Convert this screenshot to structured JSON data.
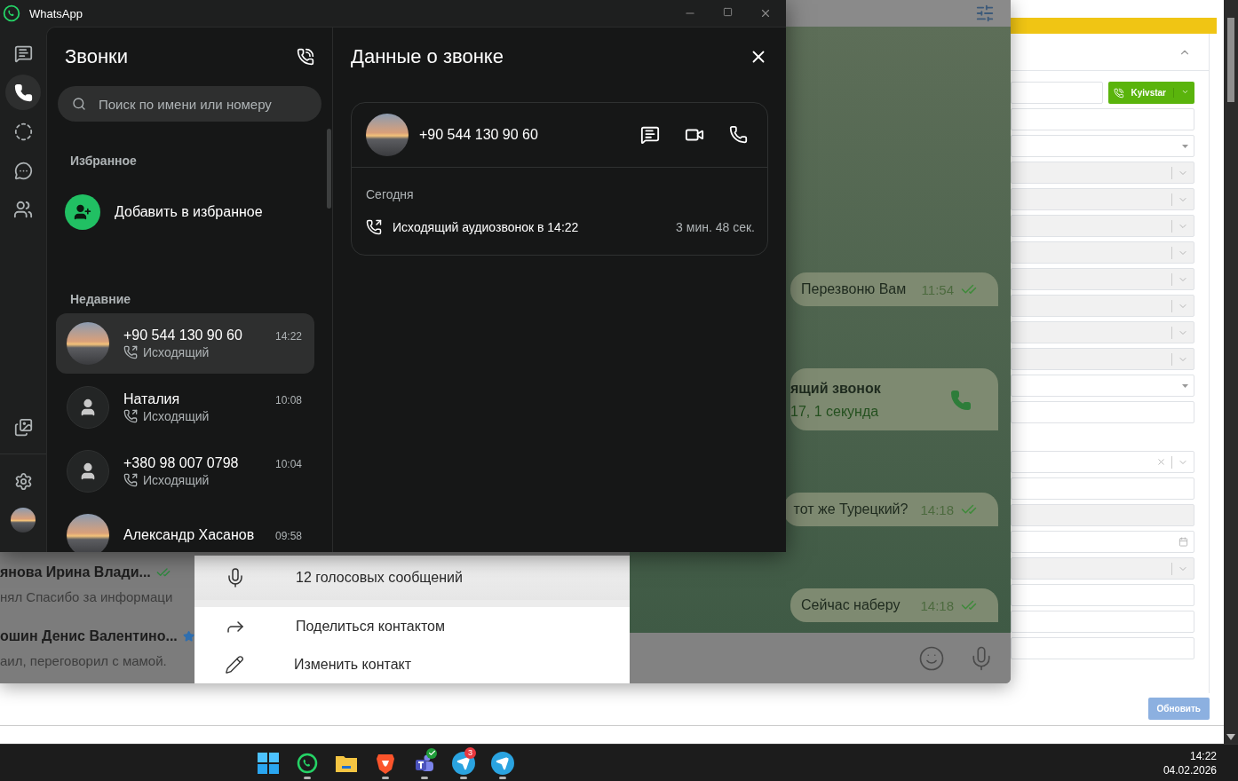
{
  "browser": {
    "dial_button": "Kyivstar",
    "update_button": "Обновить"
  },
  "telegram": {
    "chats": [
      {
        "name": "янова Ирина Влади...",
        "preview": "нял Спасибо за информаци",
        "kind": "read"
      },
      {
        "name": "ошин Денис Валентино...",
        "preview": "аил, переговорил с мамой.",
        "kind": "star"
      }
    ],
    "profile_menu": [
      {
        "kind": "voice",
        "label": "12 голосовых сообщений"
      },
      {
        "kind": "share",
        "label": "Поделиться контактом"
      },
      {
        "kind": "edit",
        "label": "Изменить контакт"
      }
    ],
    "messages": [
      {
        "kind": "text",
        "text": "Перезвоню Вам",
        "time": "11:54"
      },
      {
        "kind": "call",
        "title": "ящий звонок",
        "subtitle": "17, 1 секунда"
      },
      {
        "kind": "text",
        "text": "тот же Турецкий?",
        "time": "14:18"
      },
      {
        "kind": "text",
        "text": "Сейчас наберу",
        "time": "14:18"
      }
    ]
  },
  "whatsapp": {
    "title": "WhatsApp",
    "nav_top": [
      {
        "kind": "chats",
        "selected": false
      },
      {
        "kind": "calls",
        "selected": true
      },
      {
        "kind": "status",
        "selected": false
      },
      {
        "kind": "channels",
        "selected": false
      },
      {
        "kind": "communities",
        "selected": false
      }
    ],
    "nav_bottom": [
      {
        "kind": "media",
        "selected": false
      },
      {
        "kind": "settings",
        "selected": false
      },
      {
        "kind": "profile",
        "selected": false
      }
    ],
    "calls": {
      "title": "Звонки",
      "search": {
        "placeholder": "Поиск по имени или номеру"
      },
      "favorites_heading": "Избранное",
      "add_favorite": "Добавить в избранное",
      "recent_heading": "Недавние",
      "items": [
        {
          "name": "+90 544 130 90 60",
          "time": "14:22",
          "direction": "Исходящий",
          "kind": "photo",
          "selected": true
        },
        {
          "name": "Наталия",
          "time": "10:08",
          "direction": "Исходящий",
          "kind": "person",
          "selected": false
        },
        {
          "name": "+380 98 007 0798",
          "time": "10:04",
          "direction": "Исходящий",
          "kind": "person",
          "selected": false
        },
        {
          "name": "Александр Хасанов",
          "time": "09:58",
          "kind": "photo",
          "selected": false
        }
      ]
    },
    "details": {
      "title": "Данные о звонке",
      "contact": "+90 544 130 90 60",
      "day": "Сегодня",
      "call": "Исходящий аудиозвонок в 14:22",
      "duration": "3 мин. 48 сек."
    }
  },
  "taskbar": {
    "apps": [
      {
        "kind": "start",
        "running": false
      },
      {
        "kind": "whatsapp",
        "running": true
      },
      {
        "kind": "files",
        "running": false
      },
      {
        "kind": "brave",
        "running": true
      },
      {
        "kind": "teams",
        "running": true
      },
      {
        "kind": "telegram",
        "running": true,
        "badge": "3"
      },
      {
        "kind": "telegram",
        "running": true
      }
    ],
    "time": "14:22",
    "date": "04.02.2026"
  }
}
